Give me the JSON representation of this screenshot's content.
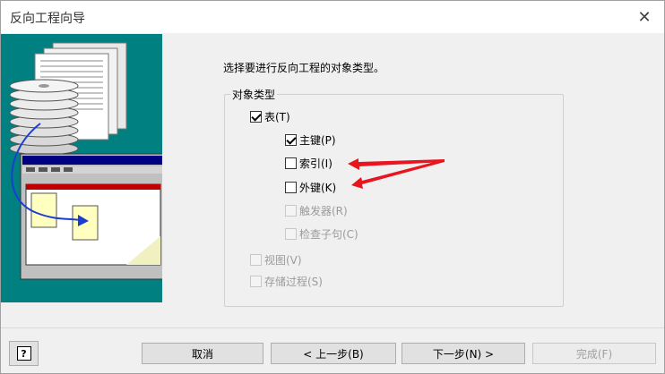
{
  "window": {
    "title": "反向工程向导"
  },
  "main": {
    "prompt": "选择要进行反向工程的对象类型。",
    "group_label": "对象类型",
    "options": [
      {
        "label": "表(T)",
        "checked": true,
        "enabled": true
      },
      {
        "label": "主键(P)",
        "checked": true,
        "enabled": true
      },
      {
        "label": "索引(I)",
        "checked": false,
        "enabled": true
      },
      {
        "label": "外键(K)",
        "checked": false,
        "enabled": true
      },
      {
        "label": "触发器(R)",
        "checked": false,
        "enabled": false
      },
      {
        "label": "检查子句(C)",
        "checked": false,
        "enabled": false
      },
      {
        "label": "视图(V)",
        "checked": false,
        "enabled": false
      },
      {
        "label": "存储过程(S)",
        "checked": false,
        "enabled": false
      }
    ]
  },
  "buttons": {
    "help": "?",
    "cancel": "取消",
    "back": "< 上一步(B)",
    "next": "下一步(N) >",
    "finish": "完成(F)"
  },
  "colors": {
    "illustration_bg": "#008080",
    "annotation_arrow": "#e8141e"
  }
}
